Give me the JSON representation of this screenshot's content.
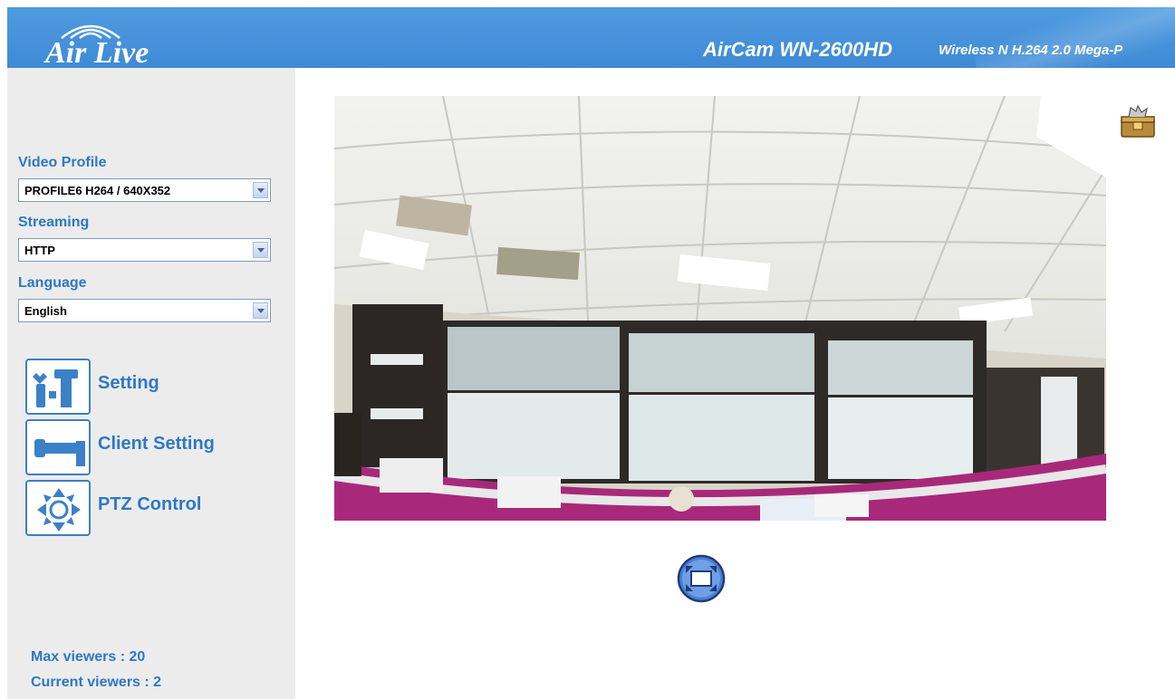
{
  "header": {
    "logo": "Air Live",
    "model": "AirCam WN-2600HD",
    "subtitle": "Wireless  N H.264 2.0 Mega-P"
  },
  "sidebar": {
    "video_profile": {
      "label": "Video Profile",
      "value": "PROFILE6 H264 / 640X352"
    },
    "streaming": {
      "label": "Streaming",
      "value": "HTTP"
    },
    "language": {
      "label": "Language",
      "value": "English"
    },
    "nav": [
      {
        "label": "Setting",
        "icon": "tools-icon"
      },
      {
        "label": "Client Setting",
        "icon": "wrench-icon"
      },
      {
        "label": "PTZ Control",
        "icon": "ptz-arrows-icon"
      }
    ],
    "max_viewers": "Max viewers : 20",
    "current_viewers": "Current viewers : 2"
  },
  "main": {
    "video_icon": "camera-live-feed",
    "snapshot_icon": "snapshot-toolbox-icon",
    "fullscreen_icon": "fullscreen-icon"
  },
  "colors": {
    "header": "#4a95dd",
    "accent_text": "#2f78c4",
    "sidebar_bg": "#ececec",
    "ceiling": "#f0f0ec",
    "partition_magenta": "#a8297a"
  }
}
